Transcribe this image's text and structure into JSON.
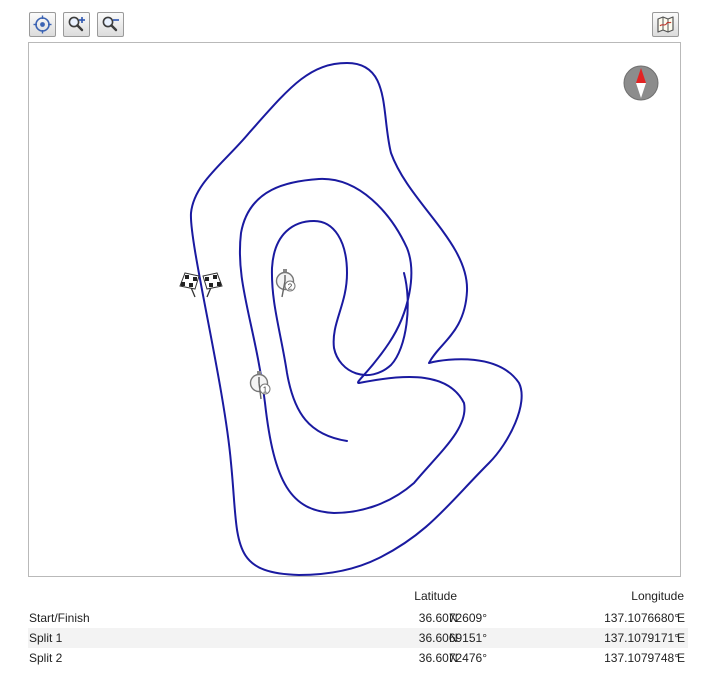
{
  "toolbar": {
    "locate_icon": "crosshair-target-icon",
    "zoom_in_icon": "magnifier-plus-icon",
    "zoom_out_icon": "magnifier-minus-icon",
    "map_toggle_icon": "folded-map-icon"
  },
  "map": {
    "track_color": "#1a1aa0",
    "compass_icon": "compass-north-icon",
    "markers": [
      {
        "name": "start-finish",
        "icon": "checkered-flags-icon"
      },
      {
        "name": "split-1",
        "icon": "stopwatch-1-icon",
        "label": "1"
      },
      {
        "name": "split-2",
        "icon": "stopwatch-2-icon",
        "label": "2"
      }
    ]
  },
  "table": {
    "headers": {
      "latitude": "Latitude",
      "longitude": "Longitude"
    },
    "rows": [
      {
        "name": "Start/Finish",
        "lat": "36.6072609°",
        "lat_dir": "N",
        "lon": "137.1076680°",
        "lon_dir": "E"
      },
      {
        "name": "Split 1",
        "lat": "36.6069151°",
        "lat_dir": "N",
        "lon": "137.1079171°",
        "lon_dir": "E"
      },
      {
        "name": "Split 2",
        "lat": "36.6072476°",
        "lat_dir": "N",
        "lon": "137.1079748°",
        "lon_dir": "E"
      }
    ]
  }
}
